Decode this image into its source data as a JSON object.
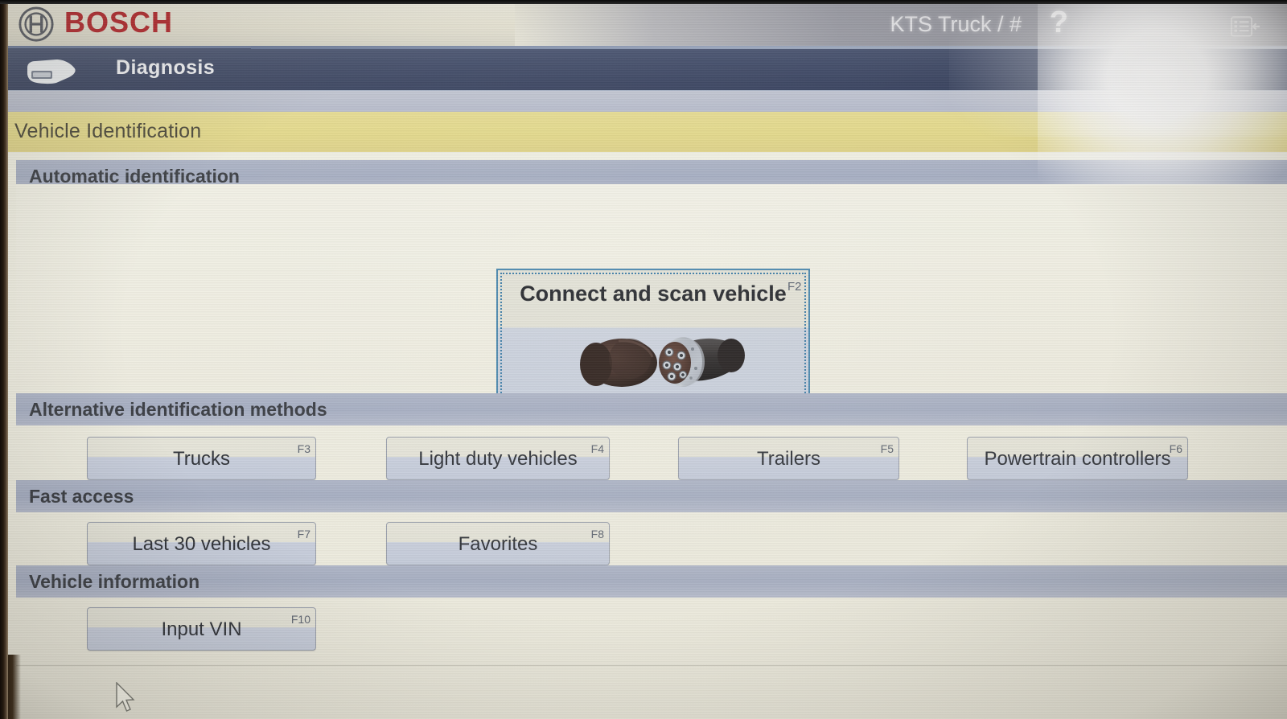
{
  "brand": {
    "name": "BOSCH",
    "logo_icon": "bosch-logo-icon"
  },
  "header": {
    "device_title": "KTS Truck / #",
    "help_icon": "question-mark-icon",
    "menu_icon": "list-menu-icon"
  },
  "appbar": {
    "tab_label": "Diagnosis",
    "tab_icon": "obd-connector-icon"
  },
  "breadcrumb": {
    "title": "Vehicle Identification"
  },
  "sections": {
    "automatic": {
      "heading": "Automatic identification",
      "scan_button": {
        "label": "Connect and scan vehicle",
        "fkey": "F2",
        "image_icon": "obd-connector-photo"
      }
    },
    "alternative": {
      "heading": "Alternative identification methods",
      "buttons": [
        {
          "label": "Trucks",
          "fkey": "F3"
        },
        {
          "label": "Light duty vehicles",
          "fkey": "F4"
        },
        {
          "label": "Trailers",
          "fkey": "F5"
        },
        {
          "label": "Powertrain controllers",
          "fkey": "F6"
        }
      ]
    },
    "fast_access": {
      "heading": "Fast access",
      "buttons": [
        {
          "label": "Last 30 vehicles",
          "fkey": "F7"
        },
        {
          "label": "Favorites",
          "fkey": "F8"
        }
      ]
    },
    "vehicle_information": {
      "heading": "Vehicle information",
      "buttons": [
        {
          "label": "Input VIN",
          "fkey": "F10"
        }
      ]
    }
  },
  "colors": {
    "brand_red": "#b4282e",
    "breadcrumb_yellow": "#e3d98c",
    "section_header": "#a6aec2",
    "focus_border": "#4a87ad",
    "appbar_navy": "#444e6a",
    "content_bg": "#eeecdf"
  },
  "cursor": {
    "icon": "mouse-pointer-icon"
  }
}
